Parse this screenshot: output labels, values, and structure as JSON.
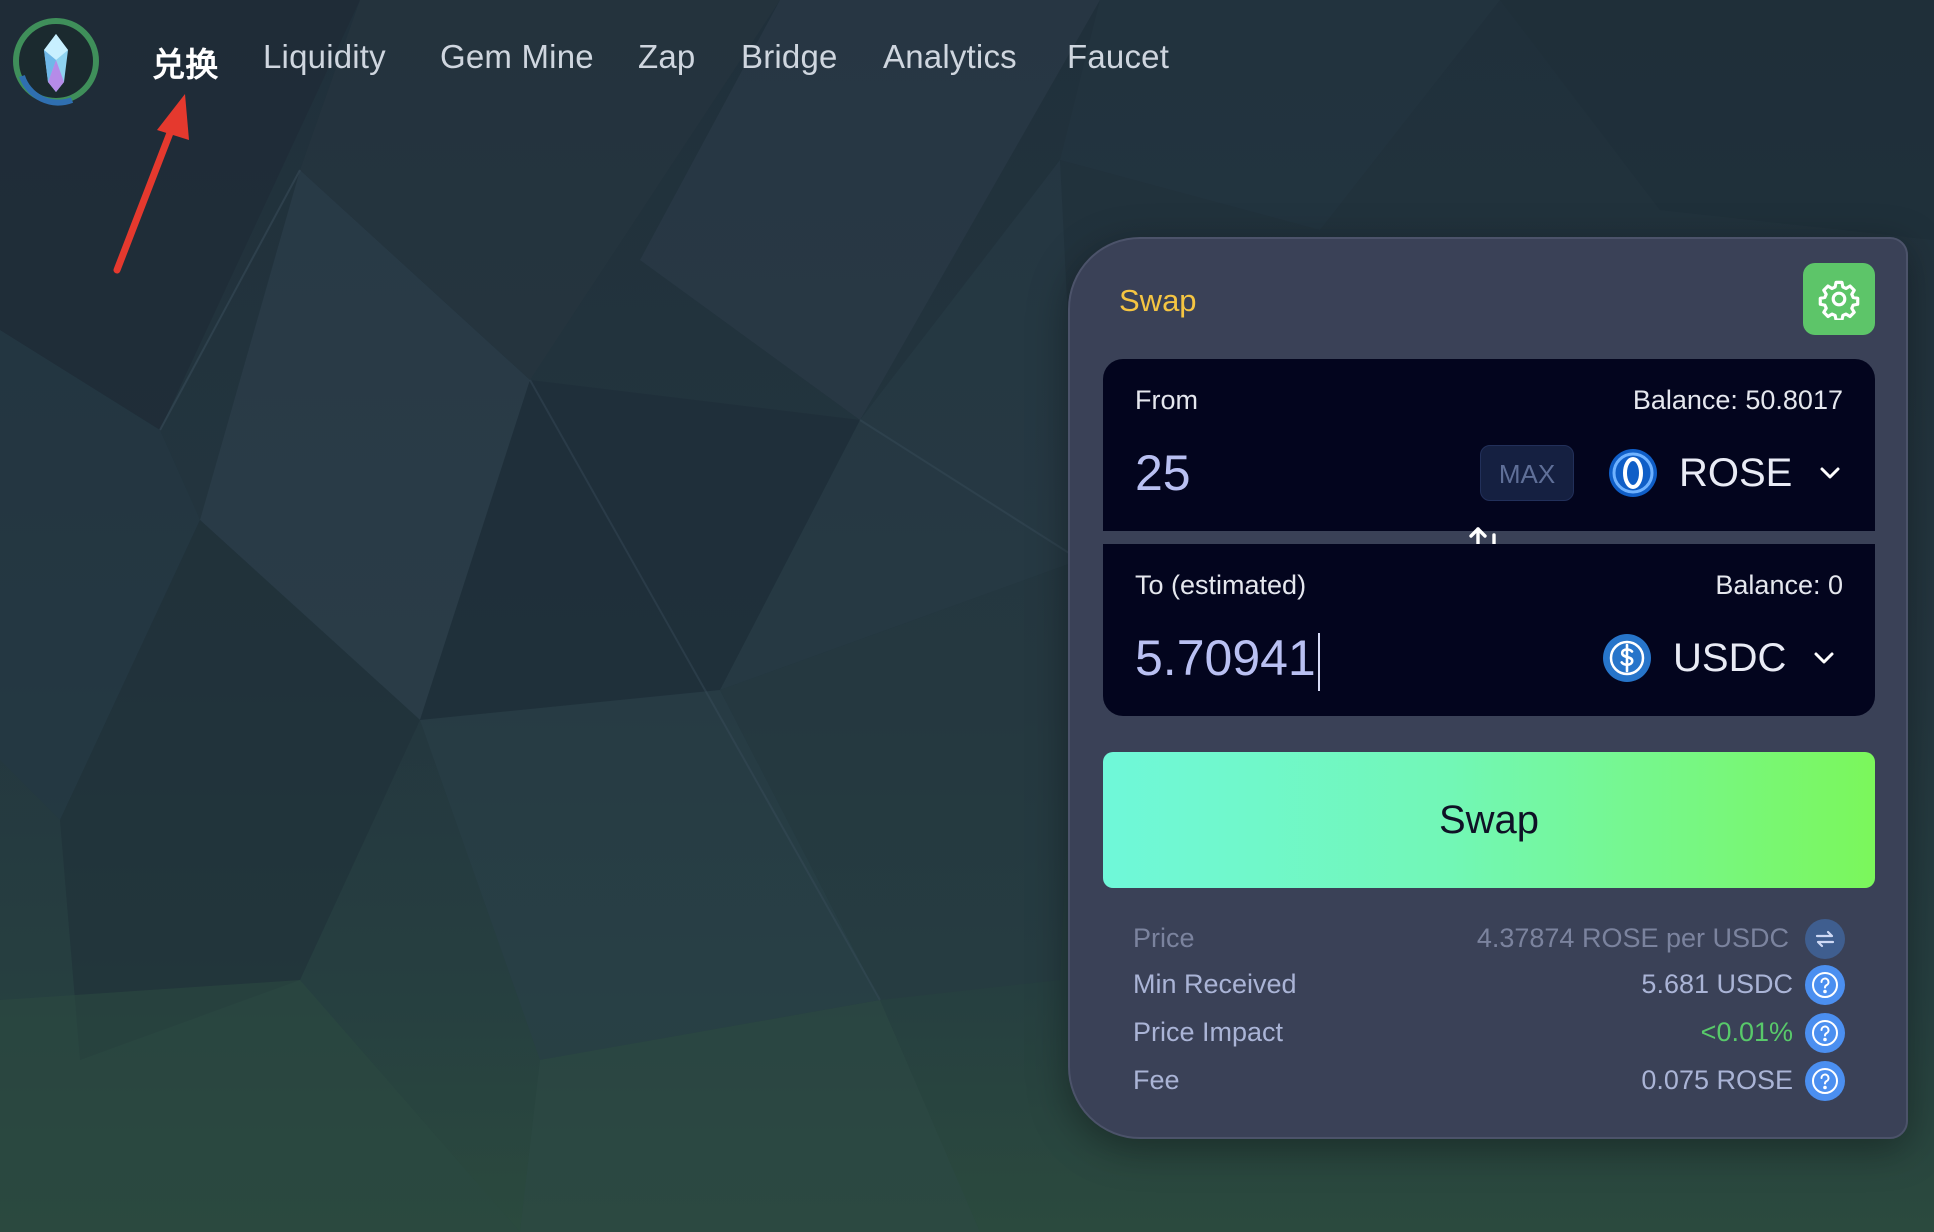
{
  "nav": {
    "items": [
      {
        "label": "兑换",
        "active": true
      },
      {
        "label": "Liquidity"
      },
      {
        "label": "Gem Mine"
      },
      {
        "label": "Zap"
      },
      {
        "label": "Bridge"
      },
      {
        "label": "Analytics"
      },
      {
        "label": "Faucet"
      }
    ]
  },
  "swap": {
    "title": "Swap",
    "from": {
      "label": "From",
      "balance": "Balance: 50.8017",
      "amount": "25",
      "max_label": "MAX",
      "token": "ROSE",
      "token_icon": "rose-token-icon"
    },
    "to": {
      "label": "To (estimated)",
      "balance": "Balance: 0",
      "amount": "5.70941",
      "token": "USDC",
      "token_icon": "usdc-token-icon"
    },
    "button_label": "Swap",
    "info": [
      {
        "label": "Price",
        "value": "4.37874 ROSE per USDC",
        "icon": "flip-icon"
      },
      {
        "label": "Min Received",
        "value": "5.681 USDC",
        "icon": "help-icon"
      },
      {
        "label": "Price Impact",
        "value": "<0.01%",
        "icon": "help-icon"
      },
      {
        "label": "Fee",
        "value": "0.075 ROSE",
        "icon": "help-icon"
      }
    ]
  },
  "colors": {
    "accent_title": "#f5c542",
    "settings_bg": "#5dc569",
    "price_impact_good": "#58c96a",
    "swap_gradient_start": "#6ff8d9",
    "swap_gradient_end": "#7bf75b"
  }
}
